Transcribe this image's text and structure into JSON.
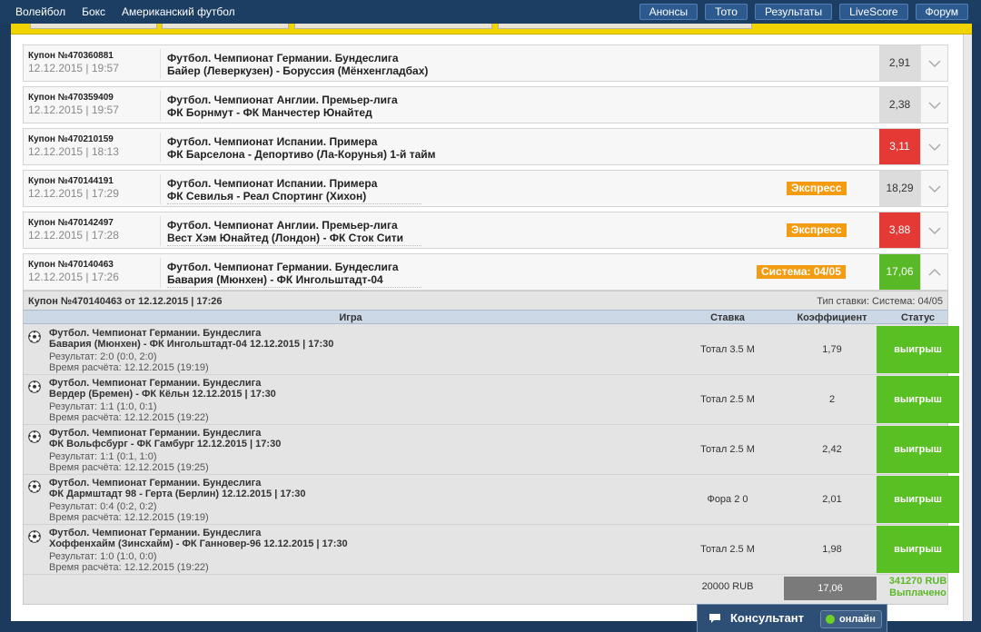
{
  "nav": {
    "left": [
      "Волейбол",
      "Бокс",
      "Американский футбол"
    ],
    "right": [
      "Анонсы",
      "Тото",
      "Результаты",
      "LiveScore",
      "Форум"
    ]
  },
  "coupons": [
    {
      "number": "Купон №470360881",
      "date": "12.12.2015 | 19:57",
      "line1": "Футбол. Чемпионат Германии. Бундеслига",
      "line2": "Байер (Леверкузен) - Боруссия (Мёнхенгладбах)",
      "badge": "",
      "odds": "2,91",
      "odds_color": "#dcdcdc"
    },
    {
      "number": "Купон №470359409",
      "date": "12.12.2015 | 19:57",
      "line1": "Футбол. Чемпионат Англии. Премьер-лига",
      "line2": "ФК Борнмут - ФК Манчестер Юнайтед",
      "badge": "",
      "odds": "2,38",
      "odds_color": "#dcdcdc"
    },
    {
      "number": "Купон №470210159",
      "date": "12.12.2015 | 18:13",
      "line1": "Футбол. Чемпионат Испании. Примера",
      "line2": "ФК Барселона - Депортиво (Ла-Корунья) 1-й тайм",
      "badge": "",
      "odds": "3,11",
      "odds_color": "#e53935"
    },
    {
      "number": "Купон №470144191",
      "date": "12.12.2015 | 17:29",
      "line1": "Футбол. Чемпионат Испании. Примера",
      "line2": "ФК Севилья - Реал Спортинг (Хихон)",
      "badge": "Экспресс",
      "odds": "18,29",
      "odds_color": "#dcdcdc"
    },
    {
      "number": "Купон №470142497",
      "date": "12.12.2015 | 17:28",
      "line1": "Футбол. Чемпионат Англии. Премьер-лига",
      "line2": "Вест Хэм Юнайтед (Лондон) - ФК Сток Сити",
      "badge": "Экспресс",
      "odds": "3,88",
      "odds_color": "#e53935"
    },
    {
      "number": "Купон №470140463",
      "date": "12.12.2015 | 17:26",
      "line1": "Футбол. Чемпионат Германии. Бундеслига",
      "line2": "Бавария (Мюнхен) - ФК Ингольштадт-04",
      "badge": "Система: 04/05",
      "odds": "17,06",
      "odds_color": "#58b825"
    }
  ],
  "detail": {
    "title": "Купон №470140463 от 12.12.2015 | 17:26",
    "bet_type": "Тип ставки: Система: 04/05",
    "headers": {
      "game": "Игра",
      "stake": "Ставка",
      "odds": "Коэффициент",
      "status": "Статус"
    },
    "bets": [
      {
        "league": "Футбол. Чемпионат Германии. Бундеслига",
        "match": "Бавария (Мюнхен) - ФК Ингольштадт-04 12.12.2015 | 17:30",
        "result": "Результат: 2:0 (0:0, 2:0)",
        "calc_time": "Время расчёта: 12.12.2015 (19:19)",
        "bet": "Тотал 3.5 М",
        "odds": "1,79",
        "status": "выигрыш"
      },
      {
        "league": "Футбол. Чемпионат Германии. Бундеслига",
        "match": "Вердер (Бремен) - ФК Кёльн 12.12.2015 | 17:30",
        "result": "Результат: 1:1 (1:0, 0:1)",
        "calc_time": "Время расчёта: 12.12.2015 (19:22)",
        "bet": "Тотал 2.5 М",
        "odds": "2",
        "status": "выигрыш"
      },
      {
        "league": "Футбол. Чемпионат Германии. Бундеслига",
        "match": "ФК Вольфсбург - ФК Гамбург 12.12.2015 | 17:30",
        "result": "Результат: 1:1 (0:1, 1:0)",
        "calc_time": "Время расчёта: 12.12.2015 (19:25)",
        "bet": "Тотал 2.5 М",
        "odds": "2,42",
        "status": "выигрыш"
      },
      {
        "league": "Футбол. Чемпионат Германии. Бундеслига",
        "match": "ФК Дармштадт 98 - Герта (Берлин) 12.12.2015 | 17:30",
        "result": "Результат: 0:4 (0:2, 0:2)",
        "calc_time": "Время расчёта: 12.12.2015 (19:19)",
        "bet": "Фора 2 0",
        "odds": "2,01",
        "status": "выигрыш"
      },
      {
        "league": "Футбол. Чемпионат Германии. Бундеслига",
        "match": "Хоффенхайм (Зинсхайм) - ФК Ганновер-96 12.12.2015 | 17:30",
        "result": "Результат: 1:0 (1:0, 0:0)",
        "calc_time": "Время расчёта: 12.12.2015 (19:22)",
        "bet": "Тотал 2.5 М",
        "odds": "1,98",
        "status": "выигрыш"
      }
    ],
    "footer": {
      "stake": "20000 RUB",
      "total_odds": "17,06",
      "payout": "341270 RUB",
      "payout_status": "Выплачено"
    }
  },
  "consultant": {
    "label": "Консультант",
    "status": "онлайн"
  }
}
